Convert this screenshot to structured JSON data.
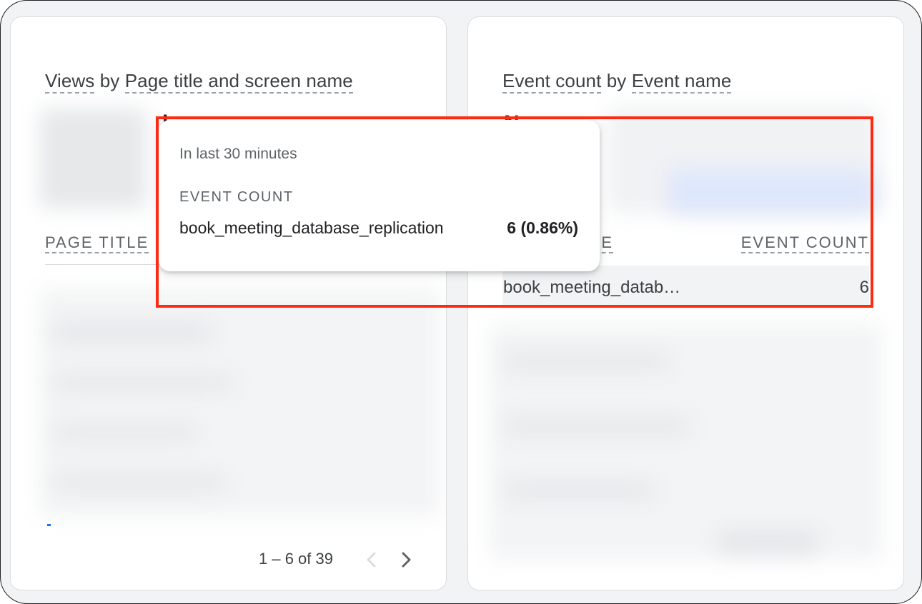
{
  "left_card": {
    "title_part1": "Views",
    "title_by": " by ",
    "title_part2": "Page title and screen name",
    "col_header": "PAGE TITLE",
    "pager_text": "1 – 6 of 39"
  },
  "right_card": {
    "title_part1": "Event count",
    "title_by": " by ",
    "title_part2": "Event name",
    "partial_label": "No. ... e",
    "col_header_left_partial": "ME",
    "col_header_right": "EVENT COUNT",
    "row": {
      "name": "book_meeting_datab…",
      "value": "6"
    }
  },
  "tooltip": {
    "subtitle": "In last 30 minutes",
    "metric_label": "EVENT COUNT",
    "event_name": "book_meeting_database_replication",
    "event_value": "6 (0.86%)"
  },
  "icons": {
    "prev": "chevron-left-icon",
    "next": "chevron-right-icon"
  },
  "colors": {
    "highlight": "#ff2a12",
    "accent_blue": "#1a73e8",
    "text_primary": "#202124",
    "text_secondary": "#5f6368"
  }
}
